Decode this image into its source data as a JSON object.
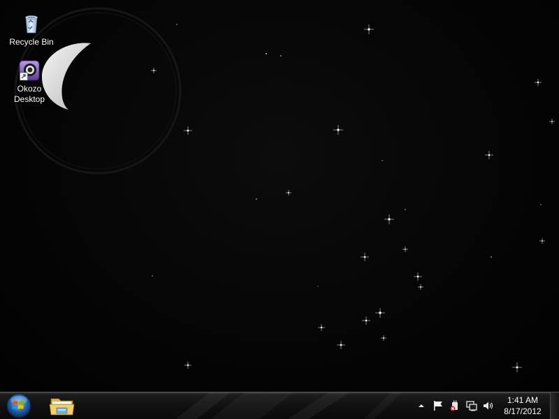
{
  "desktop": {
    "icons": [
      {
        "label": "Recycle Bin",
        "icon": "recycle-bin-icon"
      },
      {
        "label": "Okozo Desktop",
        "icon": "okozo-icon",
        "line1": "Okozo",
        "line2": "Desktop"
      }
    ]
  },
  "taskbar": {
    "start_icon": "windows-orb-icon",
    "pinned": [
      {
        "name": "Windows Explorer",
        "icon": "folder-icon"
      }
    ],
    "tray": {
      "icons": [
        "chevron-up-icon",
        "flag-icon",
        "power-icon",
        "network-icon",
        "speaker-icon"
      ]
    },
    "clock": {
      "time": "1:41 AM",
      "date": "8/17/2012"
    }
  },
  "colors": {
    "wallpaper": "#050505",
    "taskbar": "#101010",
    "moon": "#e8e8e8",
    "star": "#ffffff"
  }
}
